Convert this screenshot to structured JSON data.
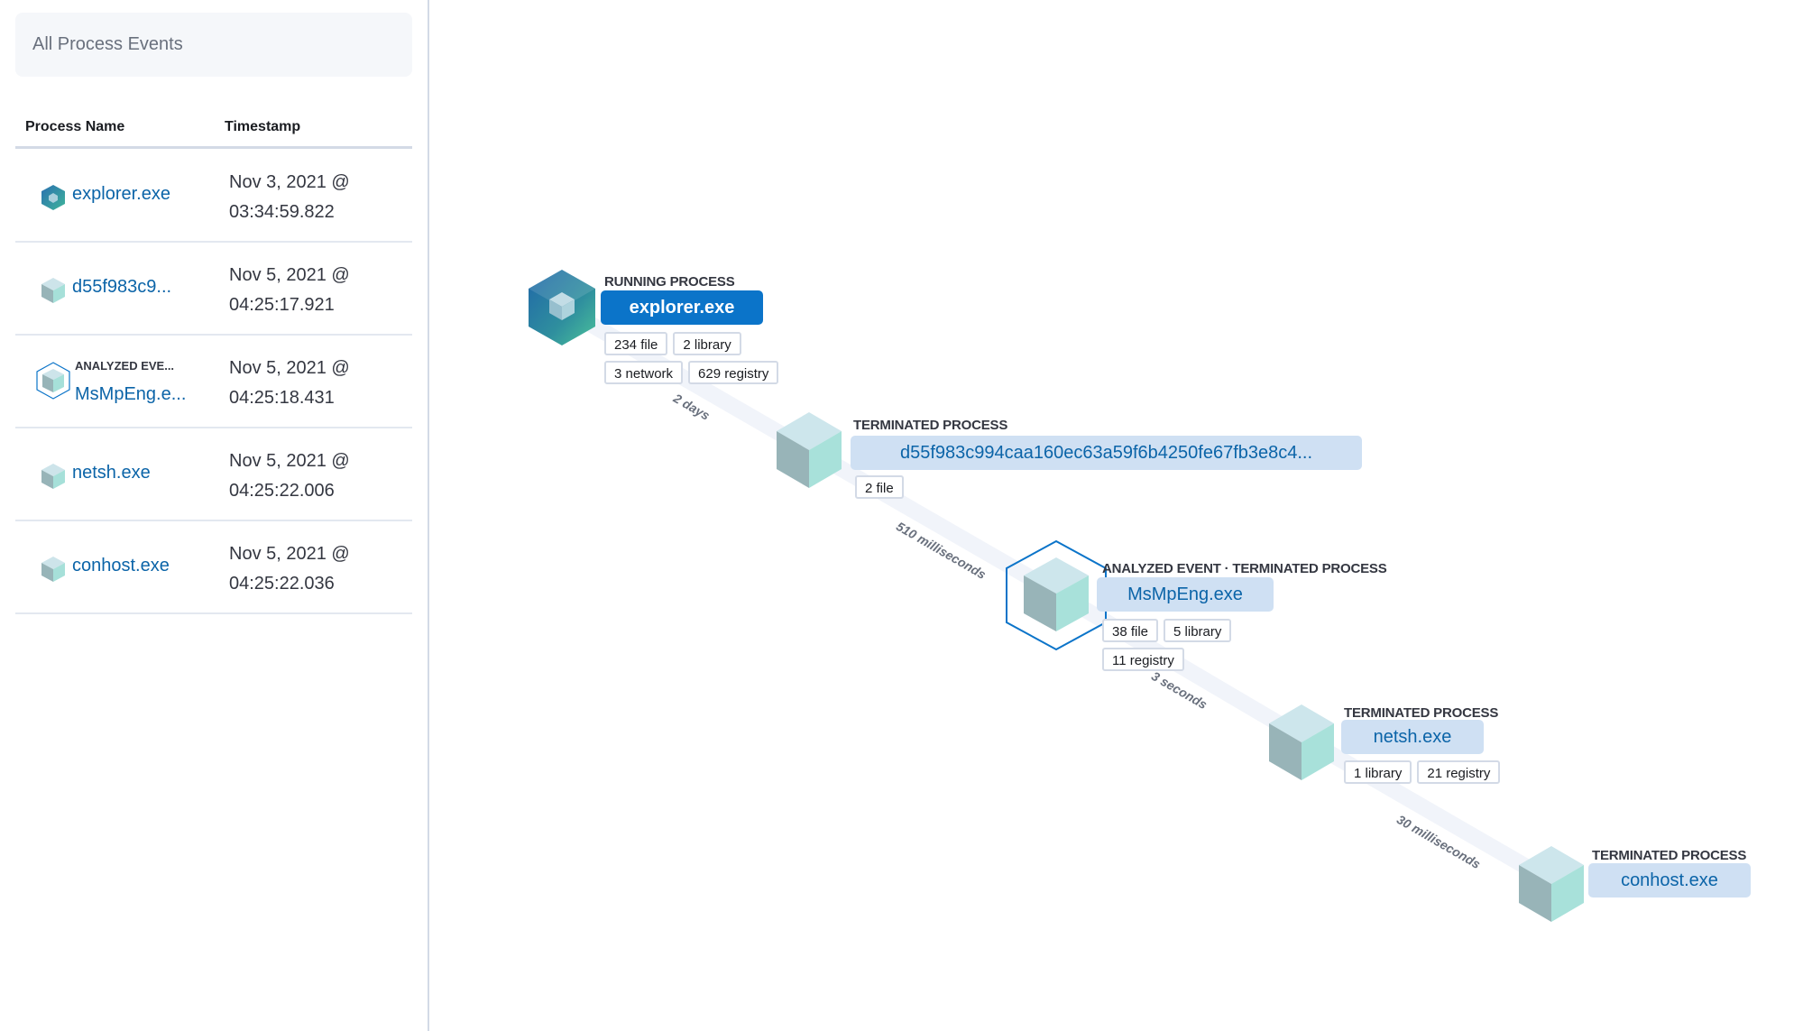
{
  "panel": {
    "title": "All Process Events",
    "columns": {
      "name": "Process Name",
      "timestamp": "Timestamp"
    },
    "rows": [
      {
        "icon": "running-process-cube-icon",
        "name": "explorer.exe",
        "tag": "",
        "date": "Nov 3, 2021 @",
        "time": "03:34:59.822"
      },
      {
        "icon": "terminated-process-cube-icon",
        "name": "d55f983c9...",
        "tag": "",
        "date": "Nov 5, 2021 @",
        "time": "04:25:17.921"
      },
      {
        "icon": "analyzed-event-cube-icon",
        "name": "MsMpEng.e...",
        "tag": "ANALYZED EVE...",
        "date": "Nov 5, 2021 @",
        "time": "04:25:18.431"
      },
      {
        "icon": "terminated-process-cube-icon",
        "name": "netsh.exe",
        "tag": "",
        "date": "Nov 5, 2021 @",
        "time": "04:25:22.006"
      },
      {
        "icon": "terminated-process-cube-icon",
        "name": "conhost.exe",
        "tag": "",
        "date": "Nov 5, 2021 @",
        "time": "04:25:22.036"
      }
    ]
  },
  "graph": {
    "nodes": [
      {
        "title": "RUNNING PROCESS",
        "label": "explorer.exe",
        "state": "running",
        "chips": [
          "234 file",
          "2 library",
          "3 network",
          "629 registry"
        ]
      },
      {
        "title": "TERMINATED PROCESS",
        "label": "d55f983c994caa160ec63a59f6b4250fe67fb3e8c4...",
        "state": "terminated",
        "chips": [
          "2 file"
        ]
      },
      {
        "title": "ANALYZED EVENT · TERMINATED PROCESS",
        "label": "MsMpEng.exe",
        "state": "analyzed",
        "chips": [
          "38 file",
          "5 library",
          "11 registry"
        ]
      },
      {
        "title": "TERMINATED PROCESS",
        "label": "netsh.exe",
        "state": "terminated",
        "chips": [
          "1 library",
          "21 registry"
        ]
      },
      {
        "title": "TERMINATED PROCESS",
        "label": "conhost.exe",
        "state": "terminated",
        "chips": []
      }
    ],
    "edges": [
      {
        "label": "2 days"
      },
      {
        "label": "510 milliseconds"
      },
      {
        "label": "3 seconds"
      },
      {
        "label": "30 milliseconds"
      }
    ]
  },
  "colors": {
    "link": "#0b64a8",
    "primary": "#0b74c9",
    "label_bg": "#cfe0f3",
    "analyzed_ring": "#0b74c9",
    "edge": "#f1f4fa"
  }
}
